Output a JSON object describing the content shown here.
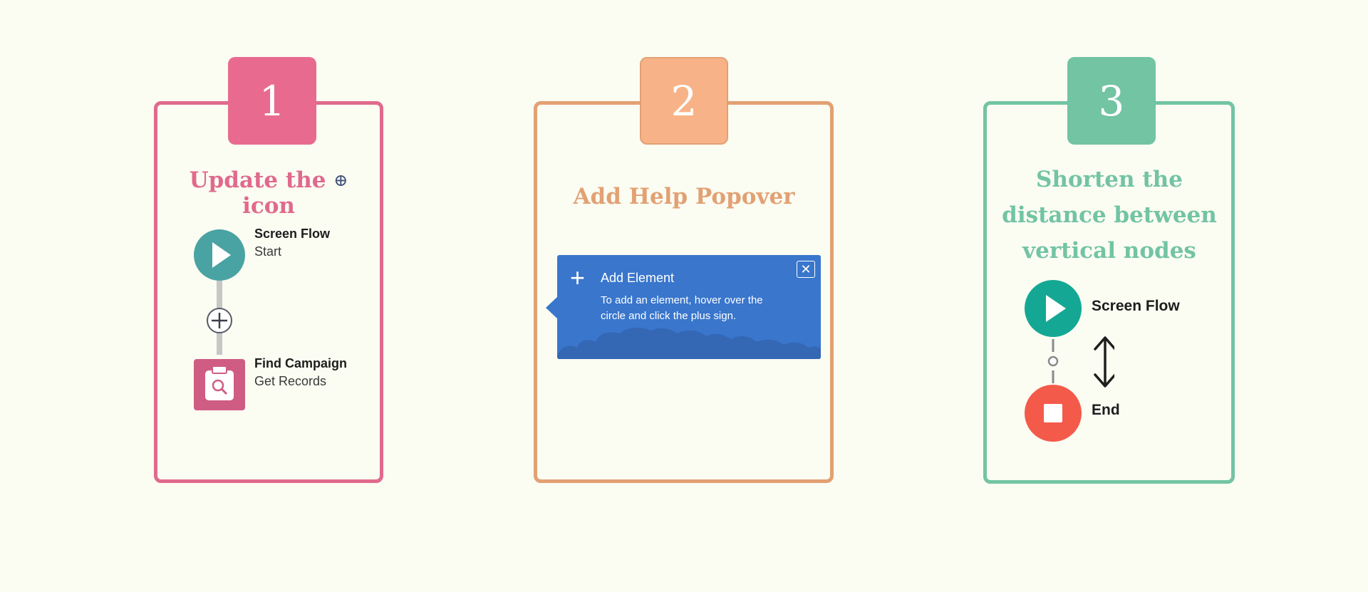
{
  "steps": [
    {
      "number": "1",
      "title_before_icon": "Update the",
      "title_icon": "⊕",
      "title_after_icon": "icon",
      "color": "#e06a8c",
      "flow": {
        "start_node": {
          "title": "Screen Flow",
          "subtitle": "Start"
        },
        "connector_icon": "plus-circle-icon",
        "record_node": {
          "title": "Find Campaign",
          "subtitle": "Get Records",
          "icon": "clipboard-search-icon"
        }
      }
    },
    {
      "number": "2",
      "title": "Add Help Popover",
      "color": "#e2a173",
      "popover": {
        "plus_glyph": "+",
        "title": "Add Element",
        "body": "To add an element, hover over the circle and click the plus sign.",
        "close_glyph": "✕",
        "background": "#3976cc"
      }
    },
    {
      "number": "3",
      "title": "Shorten the distance between vertical nodes",
      "color": "#72c4a3",
      "flow": {
        "start_node": {
          "title": "Screen Flow"
        },
        "end_node": {
          "title": "End"
        },
        "arrow_icon": "double-arrow-vertical-icon"
      }
    }
  ]
}
